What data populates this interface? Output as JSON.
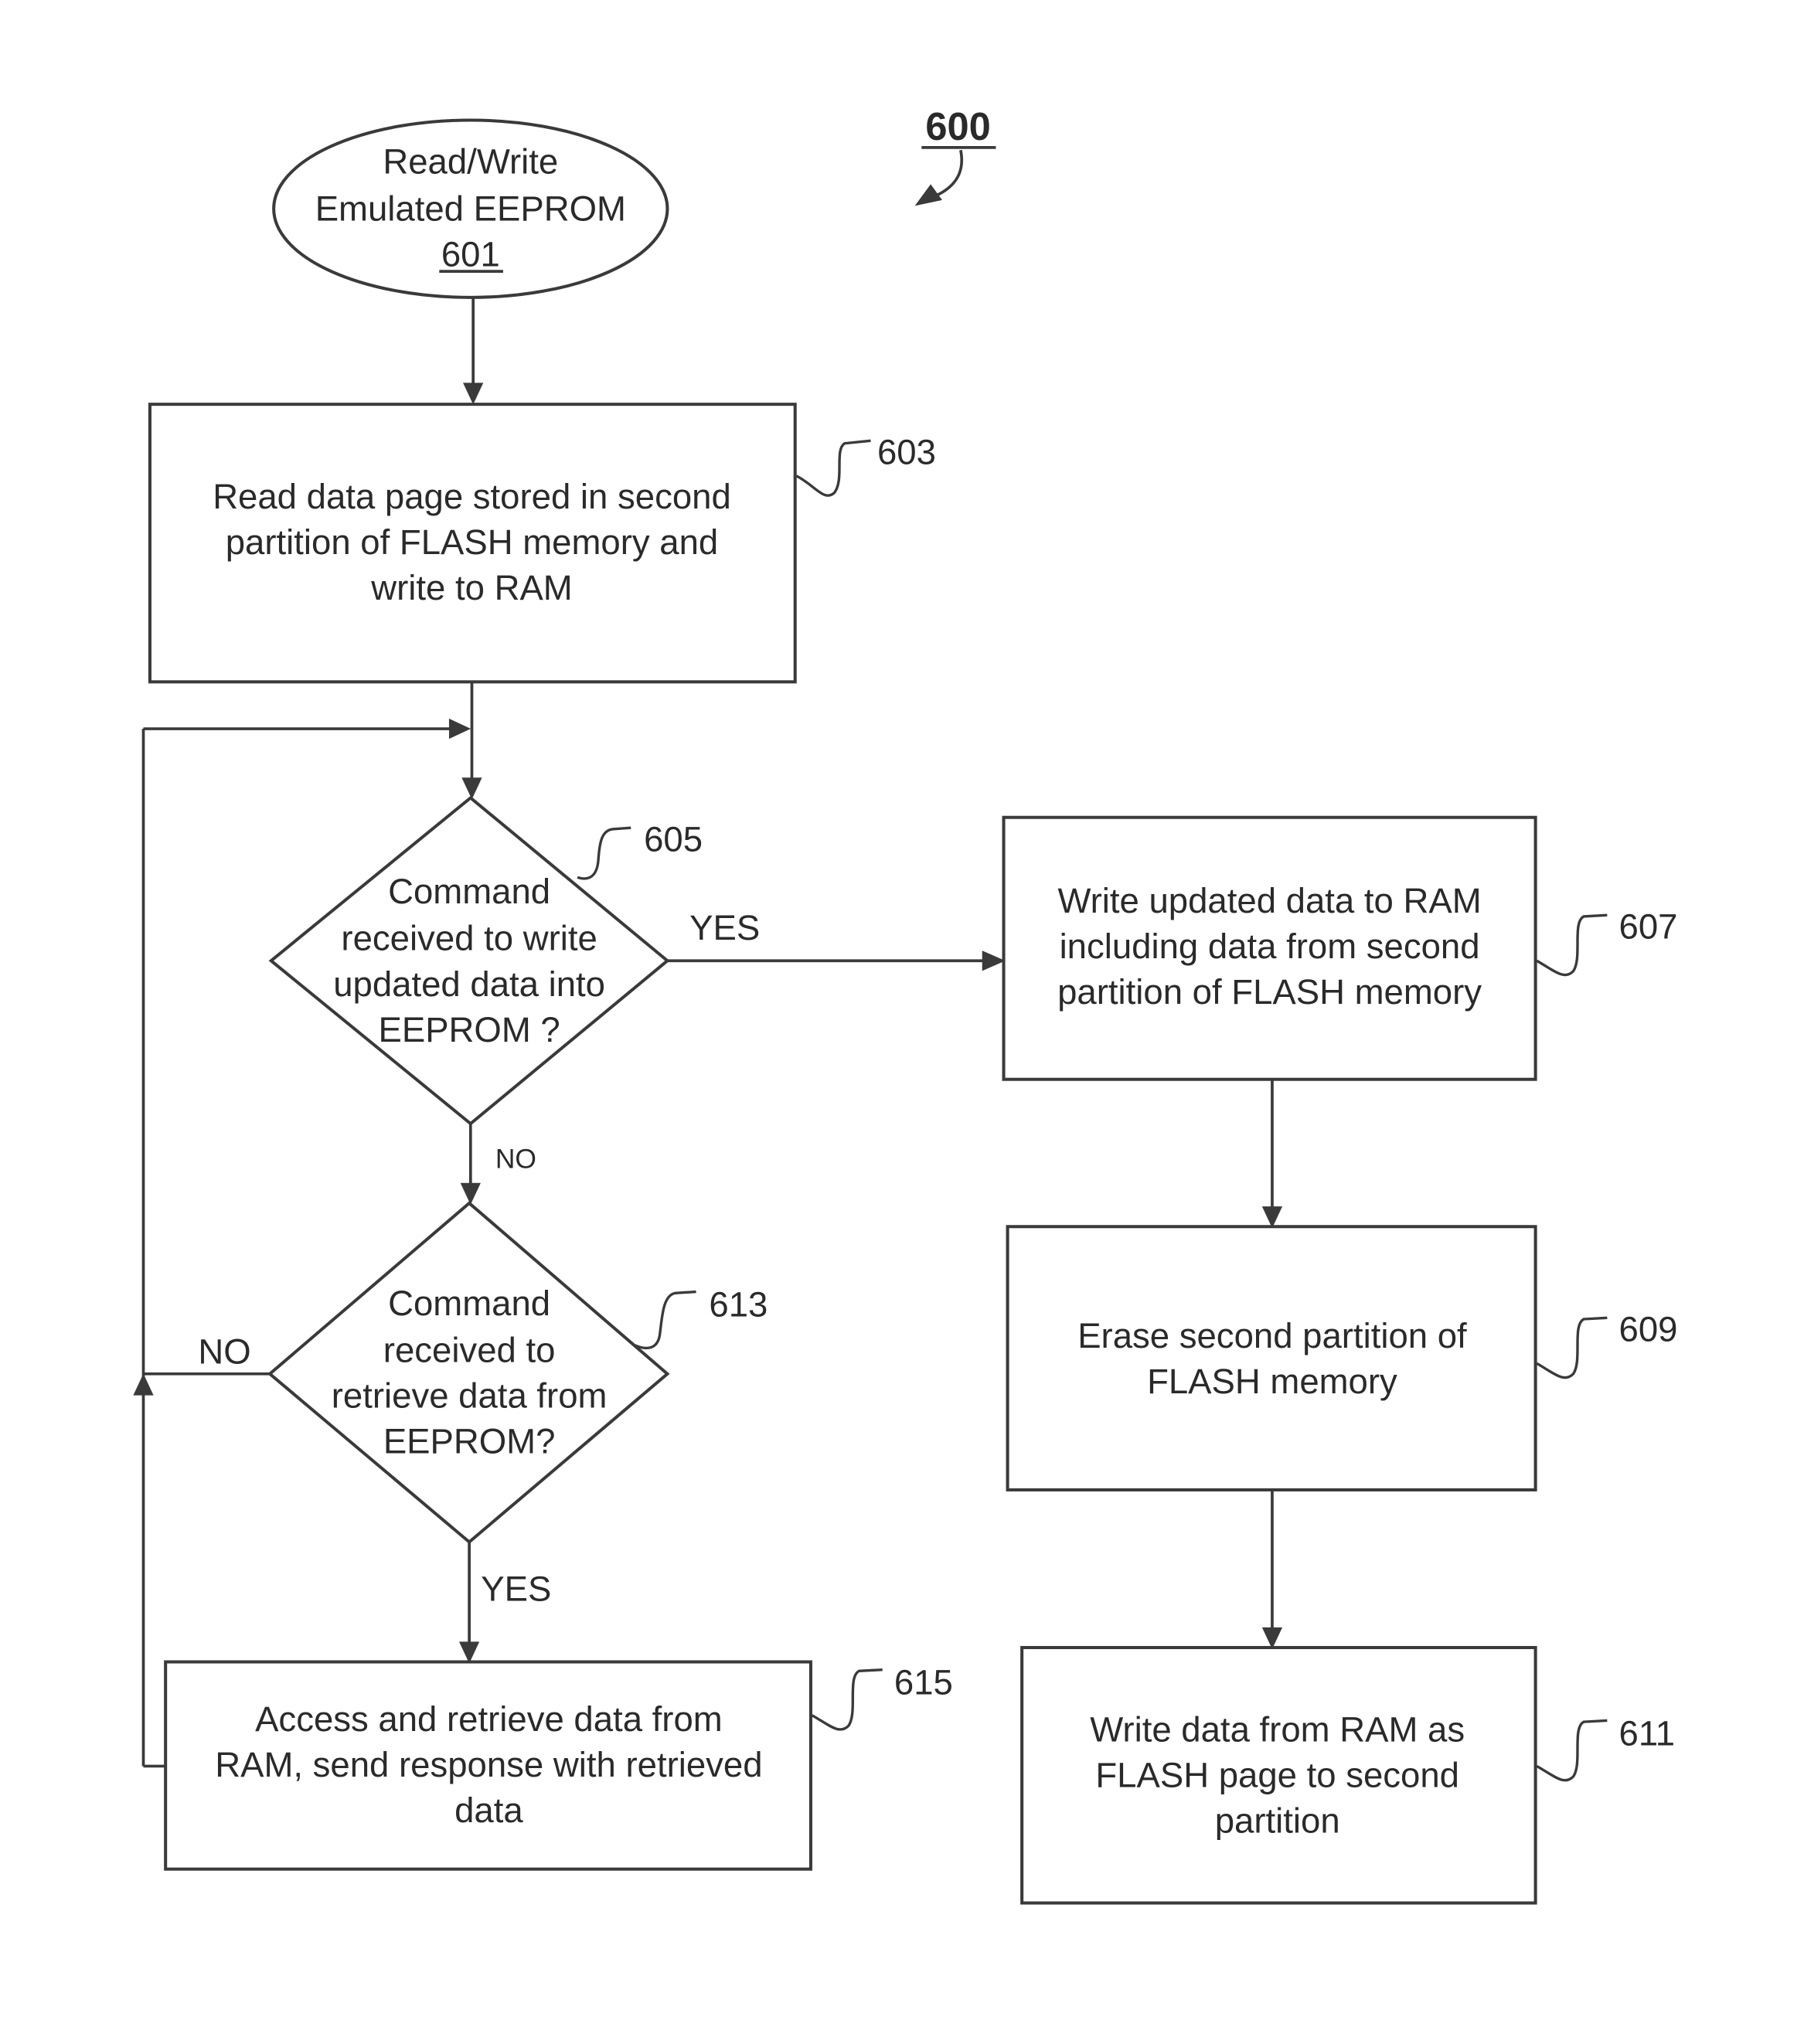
{
  "figure": {
    "number": "600"
  },
  "nodes": {
    "n601": {
      "lines": [
        "Read/Write",
        "Emulated EEPROM"
      ],
      "ref": "601"
    },
    "n603": {
      "lines": [
        "Read data page stored in second",
        "partition of FLASH memory and",
        "write to RAM"
      ],
      "ref": "603"
    },
    "n605": {
      "lines": [
        "Command",
        "received to write",
        "updated data into",
        "EEPROM ?"
      ],
      "ref": "605"
    },
    "n607": {
      "lines": [
        "Write updated data to RAM",
        "including data from second",
        "partition of FLASH memory"
      ],
      "ref": "607"
    },
    "n609": {
      "lines": [
        "Erase second partition of",
        "FLASH memory"
      ],
      "ref": "609"
    },
    "n611": {
      "lines": [
        "Write data from RAM as",
        "FLASH page to second",
        "partition"
      ],
      "ref": "611"
    },
    "n613": {
      "lines": [
        "Command",
        "received to",
        "retrieve data from",
        "EEPROM?"
      ],
      "ref": "613"
    },
    "n615": {
      "lines": [
        "Access and retrieve data from",
        "RAM, send response with retrieved",
        "data"
      ],
      "ref": "615"
    }
  },
  "edges": {
    "e605_yes": "YES",
    "e605_no": "NO",
    "e613_no": "NO",
    "e613_yes": "YES"
  }
}
